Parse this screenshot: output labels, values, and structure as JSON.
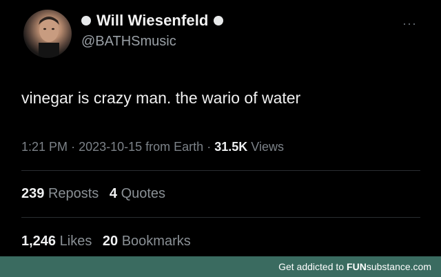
{
  "author": {
    "display_name": "Will Wiesenfeld",
    "handle": "@BATHSmusic"
  },
  "tweet": {
    "text": "vinegar is crazy man. the wario of water",
    "time": "1:21 PM",
    "date": "2023-10-15",
    "source": "from Earth",
    "views_count": "31.5K",
    "views_label": "Views"
  },
  "stats": {
    "reposts_count": "239",
    "reposts_label": "Reposts",
    "quotes_count": "4",
    "quotes_label": "Quotes",
    "likes_count": "1,246",
    "likes_label": "Likes",
    "bookmarks_count": "20",
    "bookmarks_label": "Bookmarks"
  },
  "more_menu": "···",
  "footer": {
    "prefix": "Get addicted to",
    "brand_bold": "FUN",
    "brand_rest": "substance.com"
  },
  "colors": {
    "background": "#000000",
    "footer_bg": "#3a6b60"
  }
}
